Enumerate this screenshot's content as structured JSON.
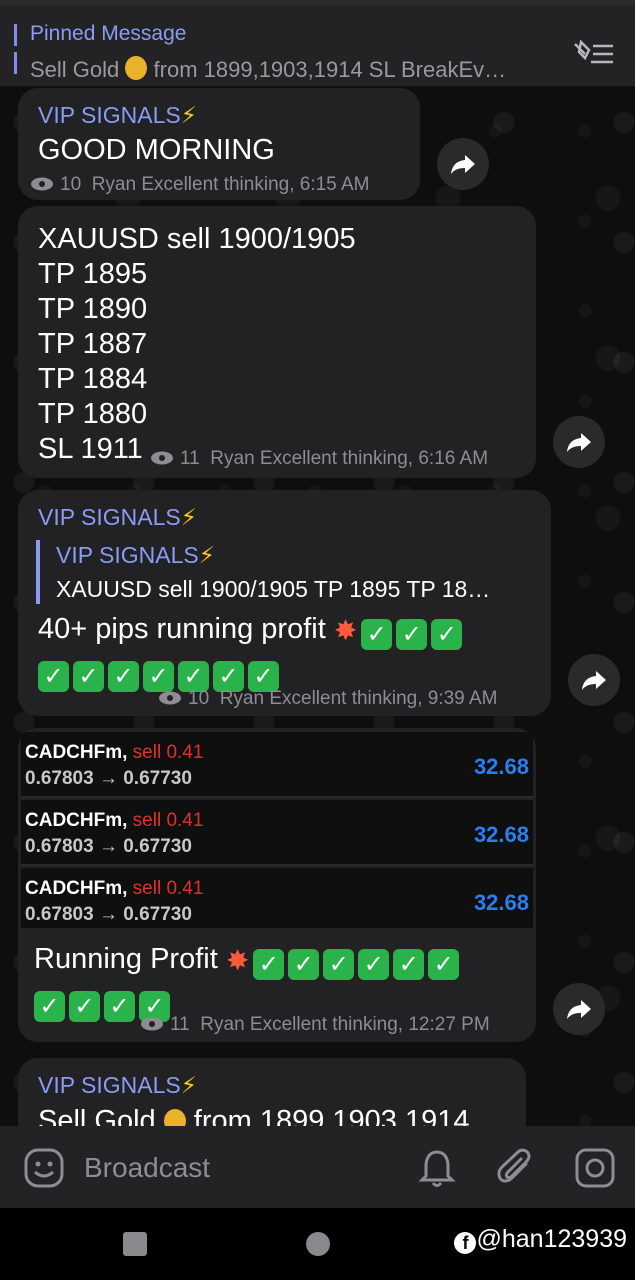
{
  "pinned": {
    "title": "Pinned Message",
    "text_before": "Sell Gold",
    "text_after": "from 1899,1903,1914 SL BreakEv…"
  },
  "messages": [
    {
      "sender": "VIP SIGNALS",
      "lines": [
        "GOOD MORNING"
      ],
      "views": "10",
      "author_time": "Ryan Excellent thinking, 6:15 AM"
    },
    {
      "lines": [
        "XAUUSD sell 1900/1905",
        "TP 1895",
        "TP 1890",
        "TP 1887",
        "TP 1884",
        "TP 1880",
        "SL 1911"
      ],
      "views": "11",
      "author_time": "Ryan Excellent thinking, 6:16 AM"
    },
    {
      "sender": "VIP SIGNALS",
      "reply_sender": "VIP SIGNALS",
      "reply_text": "XAUUSD sell 1900/1905 TP 1895 TP 18…",
      "text": "40+ pips running profit",
      "views": "10",
      "author_time": "Ryan Excellent thinking, 9:39 AM"
    },
    {
      "trades": [
        {
          "symbol": "CADCHFm,",
          "direction": "sell 0.41",
          "prices": "0.67803 → 0.67730",
          "profit": "32.68"
        },
        {
          "symbol": "CADCHFm,",
          "direction": "sell 0.41",
          "prices": "0.67803 → 0.67730",
          "profit": "32.68"
        },
        {
          "symbol": "CADCHFm,",
          "direction": "sell 0.41",
          "prices": "0.67803 → 0.67730",
          "profit": "32.68"
        }
      ],
      "text": "Running Profit",
      "views": "11",
      "author_time": "Ryan Excellent thinking, 12:27 PM"
    },
    {
      "sender": "VIP SIGNALS",
      "text_before": "Sell Gold",
      "text_after": "from 1899,1903,1914"
    }
  ],
  "input": {
    "placeholder": "Broadcast"
  },
  "watermark": "@han123939",
  "colors": {
    "accent": "#8a9bf3",
    "check": "#29b34a",
    "sell": "#e0302c",
    "profit": "#2b7ef0"
  }
}
